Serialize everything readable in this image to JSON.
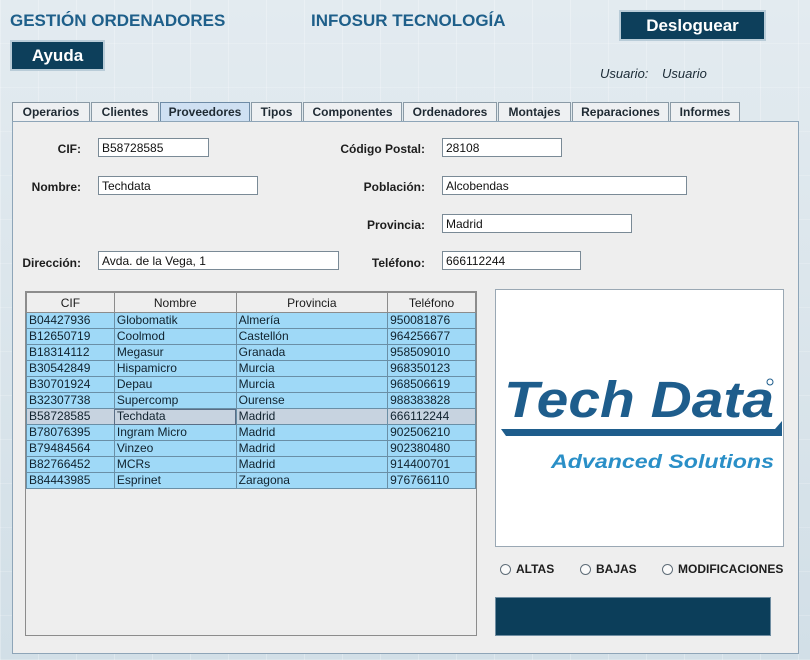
{
  "header": {
    "app_title": "GESTIÓN ORDENADORES",
    "company": "INFOSUR TECNOLOGÍA",
    "logout_label": "Desloguear",
    "help_label": "Ayuda",
    "user_label": "Usuario:",
    "user_value": "Usuario"
  },
  "tabs": [
    {
      "label": "Operarios"
    },
    {
      "label": "Clientes"
    },
    {
      "label": "Proveedores",
      "active": true
    },
    {
      "label": "Tipos"
    },
    {
      "label": "Componentes"
    },
    {
      "label": "Ordenadores"
    },
    {
      "label": "Montajes"
    },
    {
      "label": "Reparaciones"
    },
    {
      "label": "Informes"
    }
  ],
  "form": {
    "cif_label": "CIF:",
    "cif_value": "B58728585",
    "nombre_label": "Nombre:",
    "nombre_value": "Techdata",
    "direccion_label": "Dirección:",
    "direccion_value": "Avda. de la Vega, 1",
    "cp_label": "Código Postal:",
    "cp_value": "28108",
    "poblacion_label": "Población:",
    "poblacion_value": "Alcobendas",
    "provincia_label": "Provincia:",
    "provincia_value": "Madrid",
    "telefono_label": "Teléfono:",
    "telefono_value": "666112244"
  },
  "table": {
    "columns": [
      "CIF",
      "Nombre",
      "Provincia",
      "Teléfono"
    ],
    "rows": [
      [
        "B04427936",
        "Globomatik",
        "Almería",
        "950081876"
      ],
      [
        "B12650719",
        "Coolmod",
        "Castellón",
        "964256677"
      ],
      [
        "B18314112",
        "Megasur",
        "Granada",
        "958509010"
      ],
      [
        "B30542849",
        "Hispamicro",
        "Murcia",
        "968350123"
      ],
      [
        "B30701924",
        "Depau",
        "Murcia",
        "968506619"
      ],
      [
        "B32307738",
        "Supercomp",
        "Ourense",
        "988383828"
      ],
      [
        "B58728585",
        "Techdata",
        "Madrid",
        "666112244"
      ],
      [
        "B78076395",
        "Ingram Micro",
        "Madrid",
        "902506210"
      ],
      [
        "B79484564",
        "Vinzeo",
        "Madrid",
        "902380480"
      ],
      [
        "B82766452",
        "MCRs",
        "Madrid",
        "914400701"
      ],
      [
        "B84443985",
        "Esprinet",
        "Zaragona",
        "976766110"
      ]
    ],
    "selected_index": 6
  },
  "logo": {
    "brand": "Tech Data",
    "tagline": "Advanced Solutions",
    "color_main": "#1e5d8c",
    "color_tagline": "#2a8fc7"
  },
  "options": [
    {
      "label": "ALTAS"
    },
    {
      "label": "BAJAS"
    },
    {
      "label": "MODIFICACIONES"
    }
  ],
  "colors": {
    "dark_button": "#0d3f5b",
    "title": "#1e5f8a",
    "row": "#9fd9f7",
    "row_selected": "#c7d3e0"
  }
}
